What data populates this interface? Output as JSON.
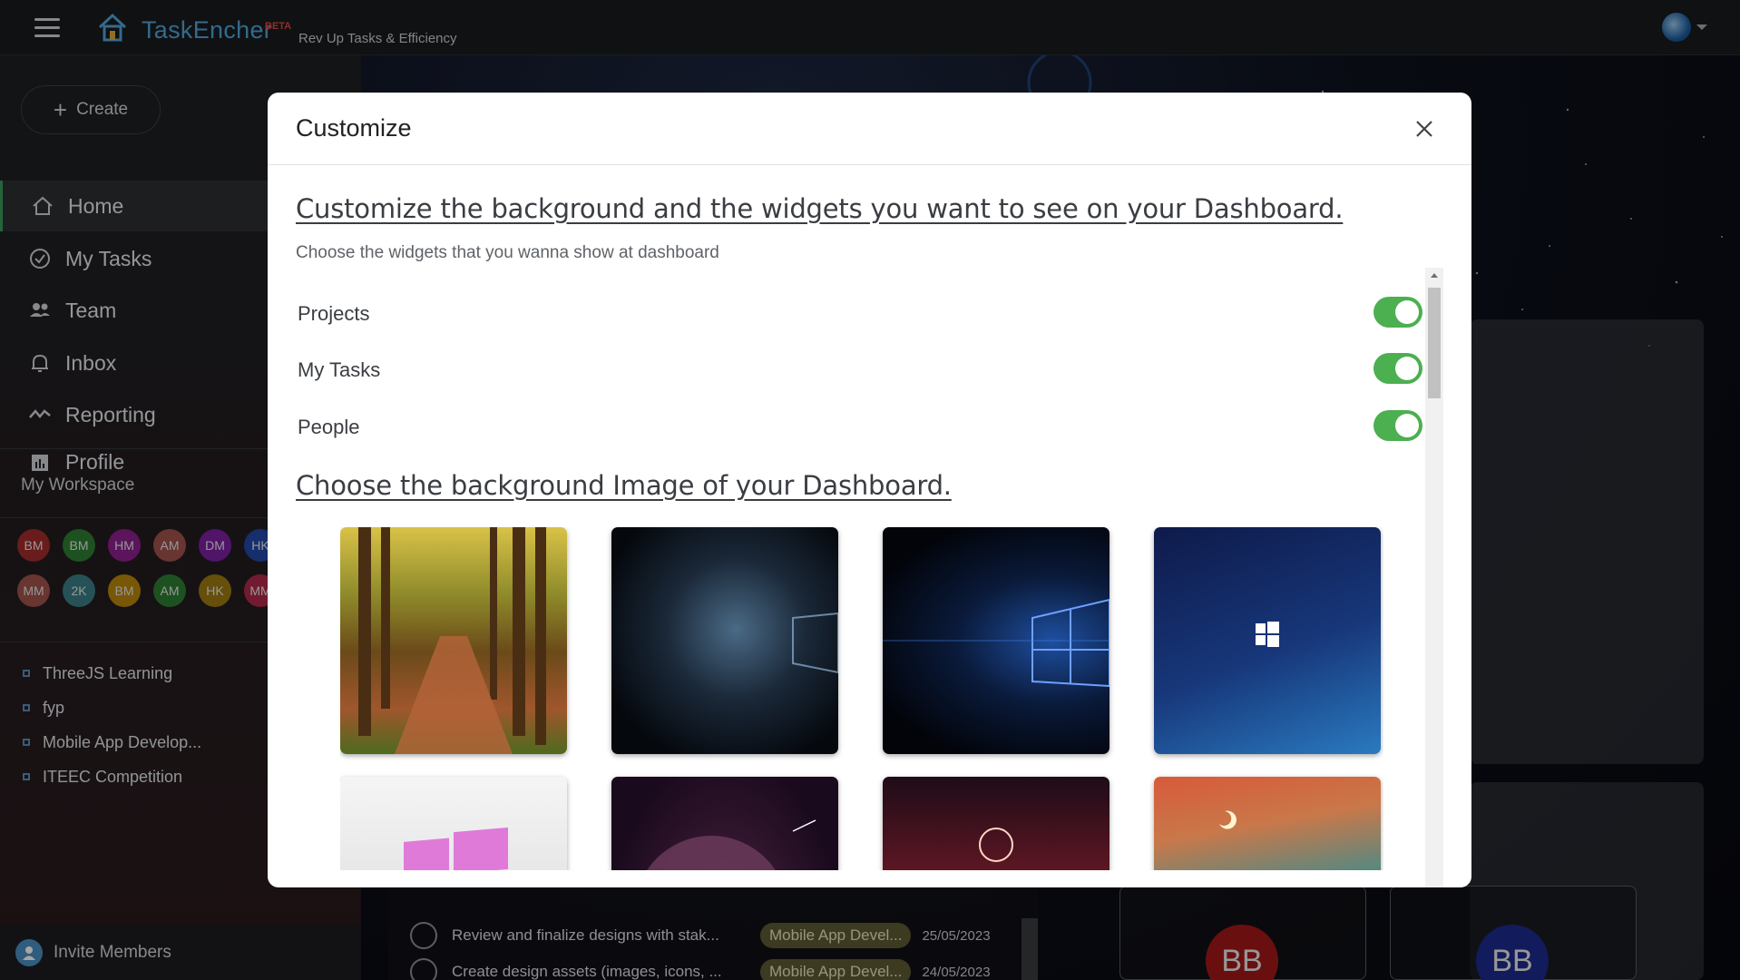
{
  "app": {
    "title": "TaskEncher",
    "badge": "BETA",
    "tagline": "Rev Up Tasks & Efficiency"
  },
  "sidebar": {
    "create_label": "Create",
    "nav": [
      {
        "label": "Home",
        "icon": "home-icon",
        "active": true
      },
      {
        "label": "My Tasks",
        "icon": "check-circle-icon"
      },
      {
        "label": "Team",
        "icon": "people-icon"
      },
      {
        "label": "Inbox",
        "icon": "bell-icon"
      },
      {
        "label": "Reporting",
        "icon": "trend-icon"
      },
      {
        "label": "Profile",
        "icon": "chart-icon"
      }
    ],
    "workspace_label": "My Workspace",
    "members_row1": [
      {
        "initials": "BM",
        "color": "#a12b2b"
      },
      {
        "initials": "BM",
        "color": "#2e7d32"
      },
      {
        "initials": "HM",
        "color": "#8e1f8e"
      },
      {
        "initials": "AM",
        "color": "#a0524a"
      },
      {
        "initials": "DM",
        "color": "#7b1fa2"
      },
      {
        "initials": "HK",
        "color": "#2348a8"
      }
    ],
    "members_row2": [
      {
        "initials": "MM",
        "color": "#a0524a"
      },
      {
        "initials": "2K",
        "color": "#3b7f86"
      },
      {
        "initials": "BM",
        "color": "#b8860b"
      },
      {
        "initials": "AM",
        "color": "#2e7d32"
      },
      {
        "initials": "HK",
        "color": "#9b7a10"
      },
      {
        "initials": "MM",
        "color": "#b02a4a"
      }
    ],
    "projects": [
      "ThreeJS Learning",
      "fyp",
      "Mobile App Develop...",
      "ITEEC Competition"
    ],
    "invite_label": "Invite Members"
  },
  "tasks": [
    {
      "name": "Review and finalize designs with stak...",
      "project": "Mobile App Devel...",
      "date": "25/05/2023"
    },
    {
      "name": "Create design assets (images, icons, ...",
      "project": "Mobile App Devel...",
      "date": "24/05/2023"
    }
  ],
  "people_cards": [
    {
      "initials": "BB",
      "color": "#a31818"
    },
    {
      "initials": "BB",
      "color": "#1c2a8c"
    }
  ],
  "modal": {
    "title": "Customize",
    "heading_widgets": "Customize the background and the widgets you want to see on your Dashboard.",
    "subtext": "Choose the widgets that you wanna show at dashboard",
    "widgets": [
      {
        "label": "Projects",
        "enabled": true
      },
      {
        "label": "My Tasks",
        "enabled": true
      },
      {
        "label": "People",
        "enabled": true
      }
    ],
    "heading_background": "Choose the background Image of your Dashboard.",
    "backgrounds": [
      "forest-path",
      "windows-dark-aurora",
      "windows-light-beam",
      "windows-blue",
      "pink-windows-logo",
      "purple-planet",
      "red-sunset-sky",
      "anime-sunset-sky"
    ],
    "toggle_color": "#4caf50"
  }
}
